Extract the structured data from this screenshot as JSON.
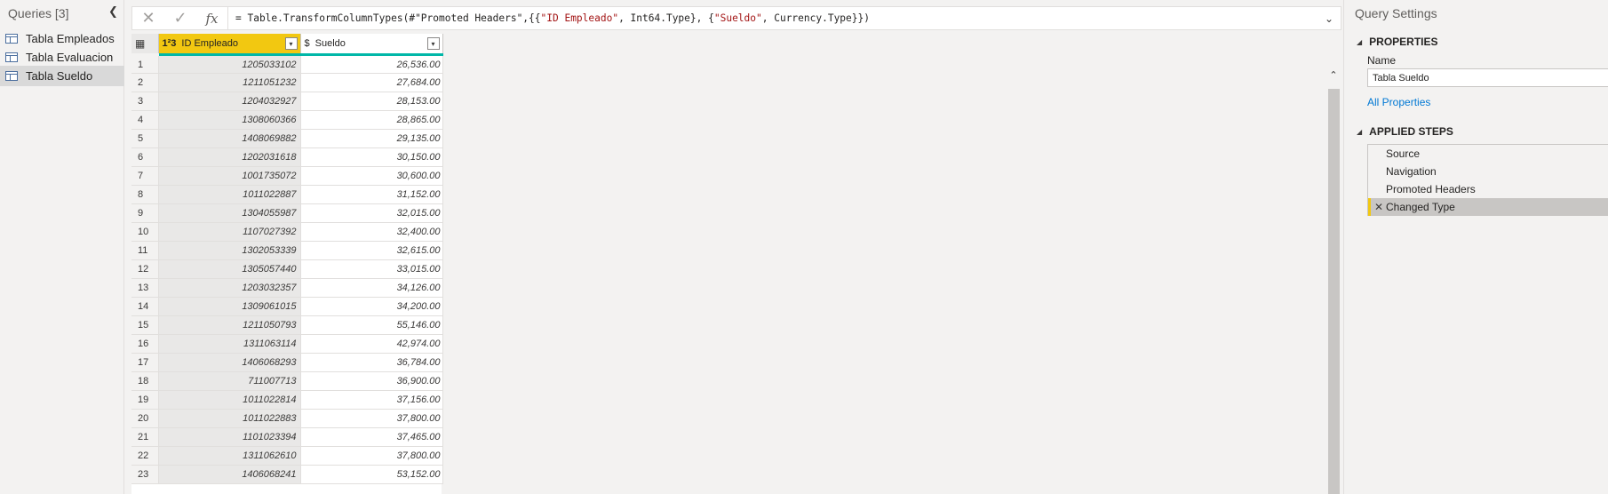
{
  "queries_pane": {
    "title": "Queries [3]",
    "collapse_glyph": "❮",
    "items": [
      {
        "label": "Tabla Empleados",
        "icon": "table-icon",
        "selected": false
      },
      {
        "label": "Tabla Evaluacion",
        "icon": "table-icon",
        "selected": false
      },
      {
        "label": "Tabla Sueldo",
        "icon": "table-icon",
        "selected": true
      }
    ]
  },
  "formula_bar": {
    "cancel_glyph": "✕",
    "commit_glyph": "✓",
    "fx_label": "fx",
    "formula_prefix": "= Table.TransformColumnTypes(#\"Promoted Headers\",{{",
    "formula_str1": "\"ID Empleado\"",
    "formula_mid1": ", Int64.Type}, {",
    "formula_str2": "\"Sueldo\"",
    "formula_suffix": ", Currency.Type}})",
    "expand_glyph": "⌄"
  },
  "grid": {
    "columns": [
      {
        "type_icon": "1²3",
        "name": "ID Empleado",
        "icon_name": "whole-number-type-icon"
      },
      {
        "type_icon": "$",
        "name": "Sueldo",
        "icon_name": "currency-type-icon"
      }
    ],
    "filter_glyph": "▾",
    "corner_glyph": "▦",
    "rows": [
      {
        "n": "1",
        "id": "1205033102",
        "sueldo": "26,536.00"
      },
      {
        "n": "2",
        "id": "1211051232",
        "sueldo": "27,684.00"
      },
      {
        "n": "3",
        "id": "1204032927",
        "sueldo": "28,153.00"
      },
      {
        "n": "4",
        "id": "1308060366",
        "sueldo": "28,865.00"
      },
      {
        "n": "5",
        "id": "1408069882",
        "sueldo": "29,135.00"
      },
      {
        "n": "6",
        "id": "1202031618",
        "sueldo": "30,150.00"
      },
      {
        "n": "7",
        "id": "1001735072",
        "sueldo": "30,600.00"
      },
      {
        "n": "8",
        "id": "1011022887",
        "sueldo": "31,152.00"
      },
      {
        "n": "9",
        "id": "1304055987",
        "sueldo": "32,015.00"
      },
      {
        "n": "10",
        "id": "1107027392",
        "sueldo": "32,400.00"
      },
      {
        "n": "11",
        "id": "1302053339",
        "sueldo": "32,615.00"
      },
      {
        "n": "12",
        "id": "1305057440",
        "sueldo": "33,015.00"
      },
      {
        "n": "13",
        "id": "1203032357",
        "sueldo": "34,126.00"
      },
      {
        "n": "14",
        "id": "1309061015",
        "sueldo": "34,200.00"
      },
      {
        "n": "15",
        "id": "1211050793",
        "sueldo": "55,146.00"
      },
      {
        "n": "16",
        "id": "1311063114",
        "sueldo": "42,974.00"
      },
      {
        "n": "17",
        "id": "1406068293",
        "sueldo": "36,784.00"
      },
      {
        "n": "18",
        "id": "711007713",
        "sueldo": "36,900.00"
      },
      {
        "n": "19",
        "id": "1011022814",
        "sueldo": "37,156.00"
      },
      {
        "n": "20",
        "id": "1011022883",
        "sueldo": "37,800.00"
      },
      {
        "n": "21",
        "id": "1101023394",
        "sueldo": "37,465.00"
      },
      {
        "n": "22",
        "id": "1311062610",
        "sueldo": "37,800.00"
      },
      {
        "n": "23",
        "id": "1406068241",
        "sueldo": "53,152.00"
      }
    ]
  },
  "scrollbar": {
    "up_glyph": "⌃"
  },
  "query_settings": {
    "title": "Query Settings",
    "properties_header": "PROPERTIES",
    "name_label": "Name",
    "name_value": "Tabla Sueldo",
    "all_properties_link": "All Properties",
    "applied_steps_header": "APPLIED STEPS",
    "collapse_glyph": "◢",
    "steps": [
      {
        "label": "Source",
        "selected": false
      },
      {
        "label": "Navigation",
        "selected": false
      },
      {
        "label": "Promoted Headers",
        "selected": false
      },
      {
        "label": "Changed Type",
        "selected": true
      }
    ],
    "delete_step_glyph": "✕"
  },
  "colors": {
    "accent_yellow": "#f2c811",
    "quality_bar_teal": "#00b7a8",
    "link_blue": "#0078d4"
  }
}
